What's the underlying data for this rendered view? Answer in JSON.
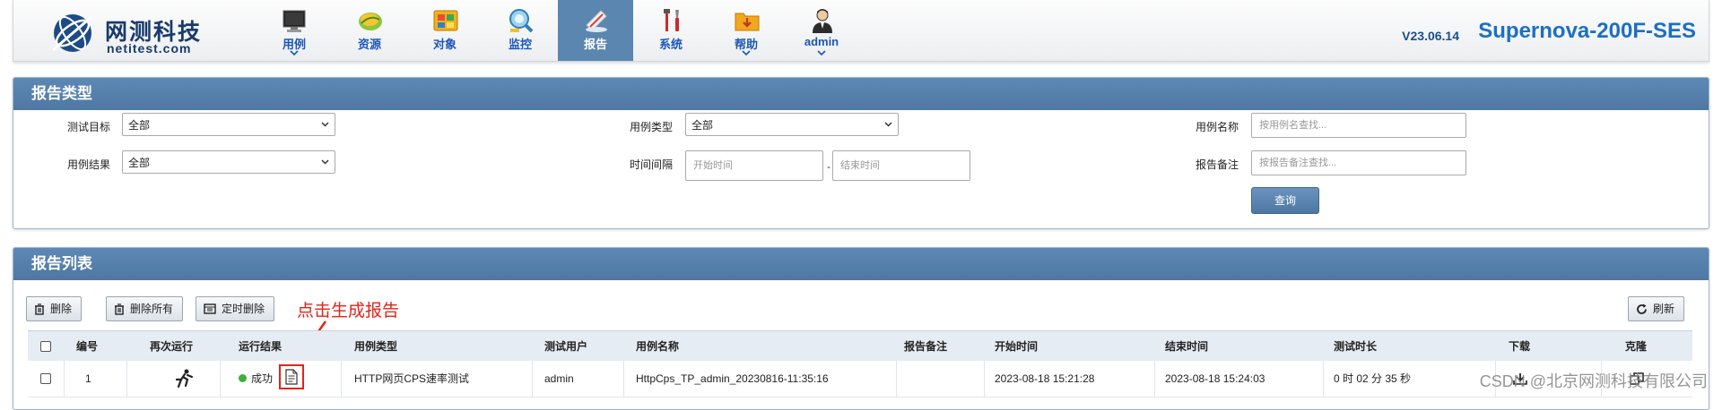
{
  "brand": {
    "name_cn": "网测科技",
    "name_en": "netitest.com",
    "version": "V23.06.14",
    "product": "Supernova-200F-SES"
  },
  "nav": [
    {
      "label": "用例",
      "icon": "testcase-icon",
      "has_menu": true,
      "active": false
    },
    {
      "label": "资源",
      "icon": "resource-icon",
      "has_menu": false,
      "active": false
    },
    {
      "label": "对象",
      "icon": "object-icon",
      "has_menu": false,
      "active": false
    },
    {
      "label": "监控",
      "icon": "monitor-icon",
      "has_menu": false,
      "active": false
    },
    {
      "label": "报告",
      "icon": "report-icon",
      "has_menu": false,
      "active": true
    },
    {
      "label": "系统",
      "icon": "system-tools-icon",
      "has_menu": false,
      "active": false
    },
    {
      "label": "帮助",
      "icon": "help-folder-icon",
      "has_menu": true,
      "active": false
    },
    {
      "label": "admin",
      "icon": "user-icon",
      "has_menu": true,
      "active": false
    }
  ],
  "filter": {
    "title": "报告类型",
    "test_target_label": "测试目标",
    "test_target_value": "全部",
    "case_type_label": "用例类型",
    "case_type_value": "全部",
    "case_name_label": "用例名称",
    "case_name_placeholder": "按用例名查找...",
    "case_result_label": "用例结果",
    "case_result_value": "全部",
    "time_range_label": "时间间隔",
    "start_placeholder": "开始时间",
    "range_separator": "-",
    "end_placeholder": "结束时间",
    "remark_label": "报告备注",
    "remark_placeholder": "按报告备注查找...",
    "query_label": "查询"
  },
  "list": {
    "title": "报告列表",
    "toolbar": {
      "delete": "删除",
      "delete_all": "删除所有",
      "scheduled_delete": "定时删除",
      "refresh": "刷新"
    },
    "annotation": "点击生成报告",
    "columns": [
      "编号",
      "再次运行",
      "运行结果",
      "用例类型",
      "测试用户",
      "用例名称",
      "报告备注",
      "开始时间",
      "结束时间",
      "测试时长",
      "下载",
      "克隆"
    ],
    "rows": [
      {
        "id": "1",
        "result": "成功",
        "case_type": "HTTP网页CPS速率测试",
        "user": "admin",
        "case_name": "HttpCps_TP_admin_20230816-11:35:16",
        "remark": "",
        "start": "2023-08-18 15:21:28",
        "end": "2023-08-18 15:24:03",
        "duration": "0 时 02 分 35 秒"
      }
    ]
  },
  "watermark": "CSDN @北京网测科技有限公司",
  "colors": {
    "header_blue": "#5a86b0",
    "nav_text": "#1c57b7",
    "annotation_red": "#e3231b",
    "success_green": "#3fae3a",
    "product_blue": "#1c6fc4"
  }
}
